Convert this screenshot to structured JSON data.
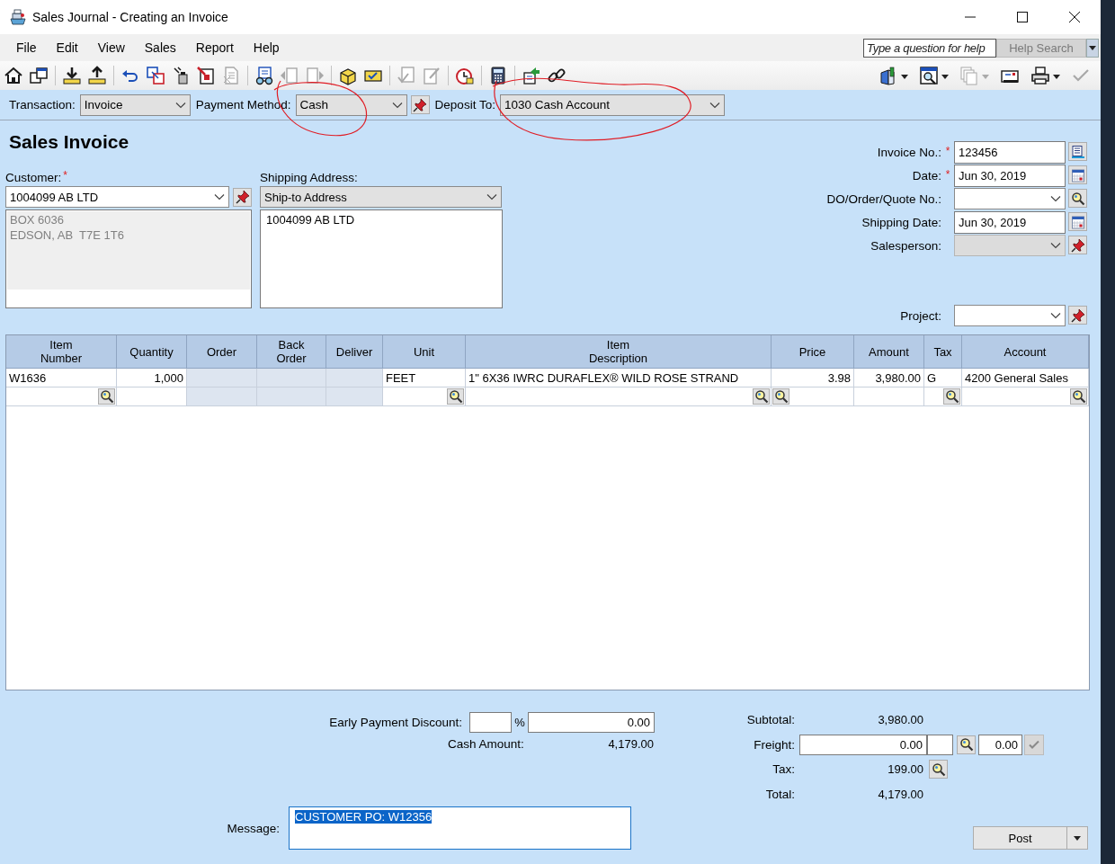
{
  "window": {
    "title": "Sales Journal - Creating an Invoice"
  },
  "menu": [
    "File",
    "Edit",
    "View",
    "Sales",
    "Report",
    "Help"
  ],
  "help_search": {
    "placeholder": "Type a question for help",
    "button": "Help Search"
  },
  "toolbar": {
    "left": [
      [
        {
          "kind": "home",
          "disabled": false
        },
        {
          "kind": "windows",
          "disabled": false
        }
      ],
      [
        {
          "kind": "download",
          "disabled": false
        },
        {
          "kind": "upload",
          "disabled": false
        }
      ],
      [
        {
          "kind": "undo",
          "disabled": false
        },
        {
          "kind": "copy",
          "disabled": false
        },
        {
          "kind": "eraser",
          "disabled": false
        },
        {
          "kind": "form",
          "disabled": false
        },
        {
          "kind": "document",
          "disabled": true
        }
      ],
      [
        {
          "kind": "glasses",
          "disabled": false
        },
        {
          "kind": "previous",
          "disabled": true
        },
        {
          "kind": "next",
          "disabled": true
        }
      ],
      [
        {
          "kind": "box",
          "disabled": false
        },
        {
          "kind": "card",
          "disabled": false
        }
      ],
      [
        {
          "kind": "doccheck",
          "disabled": true
        },
        {
          "kind": "docedit",
          "disabled": true
        }
      ],
      [
        {
          "kind": "clock",
          "disabled": false
        }
      ],
      [
        {
          "kind": "calculator",
          "disabled": false
        }
      ],
      [
        {
          "kind": "transfer",
          "disabled": false
        },
        {
          "kind": "link",
          "disabled": false
        }
      ]
    ],
    "right": [
      {
        "kind": "cabinet",
        "dropdown": true,
        "disabled": false
      },
      {
        "kind": "searchwindow",
        "dropdown": true,
        "disabled": false
      },
      {
        "kind": "copies",
        "dropdown": true,
        "disabled": true
      },
      {
        "kind": "envelope",
        "dropdown": false,
        "disabled": false
      },
      {
        "kind": "printer",
        "dropdown": true,
        "disabled": false
      },
      {
        "kind": "check",
        "dropdown": false,
        "disabled": true
      }
    ]
  },
  "transaction_bar": {
    "transaction": {
      "label": "Transaction:",
      "value": "Invoice"
    },
    "payment_method": {
      "label": "Payment Method:",
      "value": "Cash"
    },
    "deposit_to": {
      "label": "Deposit To:",
      "value": "1030 Cash Account"
    }
  },
  "form_title": "Sales Invoice",
  "customer": {
    "label": "Customer:",
    "required": true,
    "value": "1004099 AB LTD",
    "address": [
      "BOX 6036",
      "EDSON, AB  T7E 1T6"
    ]
  },
  "shipping": {
    "label": "Shipping Address:",
    "value": "Ship-to Address",
    "address": [
      "1004099 AB LTD"
    ]
  },
  "required_marker": "*",
  "details": [
    {
      "kind": "text",
      "label": "Invoice No.:",
      "required": true,
      "value": "123456",
      "button": {
        "kind": "number"
      },
      "disabled": false
    },
    {
      "kind": "text",
      "label": "Date:",
      "required": true,
      "value": "Jun 30, 2019",
      "button": {
        "kind": "calendar"
      },
      "disabled": false
    },
    {
      "kind": "dropdown",
      "label": "DO/Order/Quote No.:",
      "required": false,
      "button": {
        "kind": "lookup"
      },
      "disabled": false
    },
    {
      "kind": "text",
      "label": "Shipping Date:",
      "required": false,
      "value": "Jun 30, 2019",
      "button": {
        "kind": "calendar"
      },
      "disabled": false
    },
    {
      "kind": "dropdown",
      "label": "Salesperson:",
      "required": false,
      "button": {
        "kind": "pin"
      },
      "disabled": true
    }
  ],
  "project": {
    "label": "Project:",
    "button": {
      "kind": "pin"
    }
  },
  "table": {
    "columns": [
      {
        "label": "Item\nNumber",
        "numeric": false,
        "shaded": false,
        "lookup": {
          "kind": "end"
        }
      },
      {
        "label": "Quantity",
        "numeric": true,
        "shaded": false
      },
      {
        "label": "Order",
        "numeric": true,
        "shaded": true
      },
      {
        "label": "Back\nOrder",
        "numeric": true,
        "shaded": true
      },
      {
        "label": "Deliver",
        "numeric": true,
        "shaded": true
      },
      {
        "label": "Unit",
        "numeric": false,
        "shaded": false,
        "lookup": {
          "kind": "end"
        }
      },
      {
        "label": "Item\nDescription",
        "numeric": false,
        "shaded": false,
        "lookup": {
          "kind": "end"
        }
      },
      {
        "label": "Price",
        "numeric": true,
        "shaded": false,
        "lookup": {
          "kind": "start"
        }
      },
      {
        "label": "Amount",
        "numeric": true,
        "shaded": false
      },
      {
        "label": "Tax",
        "numeric": false,
        "shaded": false,
        "lookup": {
          "kind": "end"
        }
      },
      {
        "label": "Account",
        "numeric": false,
        "shaded": false,
        "lookup": {
          "kind": "end"
        }
      }
    ],
    "rows": [
      {
        "item_number": "W1636",
        "quantity": "1,000",
        "unit": "FEET",
        "item_description": "1\" 6X36 IWRC DURAFLEX® WILD ROSE STRAND",
        "price": "3.98",
        "amount": "3,980.00",
        "tax": "G",
        "account": "4200 General Sales"
      }
    ]
  },
  "discount": {
    "label": "Early Payment Discount:",
    "percent_sign": "%",
    "amount": "0.00"
  },
  "cash_amount": {
    "label": "Cash Amount:",
    "value": "4,179.00"
  },
  "totals": {
    "subtotal": {
      "label": "Subtotal:",
      "value": "3,980.00"
    },
    "freight": {
      "label": "Freight:",
      "value": "0.00",
      "tax_value": "0.00"
    },
    "tax": {
      "label": "Tax:",
      "value": "199.00"
    },
    "total": {
      "label": "Total:",
      "value": "4,179.00"
    }
  },
  "message": {
    "label": "Message:",
    "value": "CUSTOMER PO: W12356",
    "selected": true
  },
  "post_button": {
    "label": "Post"
  },
  "annotations": [
    {
      "kind": "circle"
    },
    {
      "kind": "circle"
    }
  ]
}
